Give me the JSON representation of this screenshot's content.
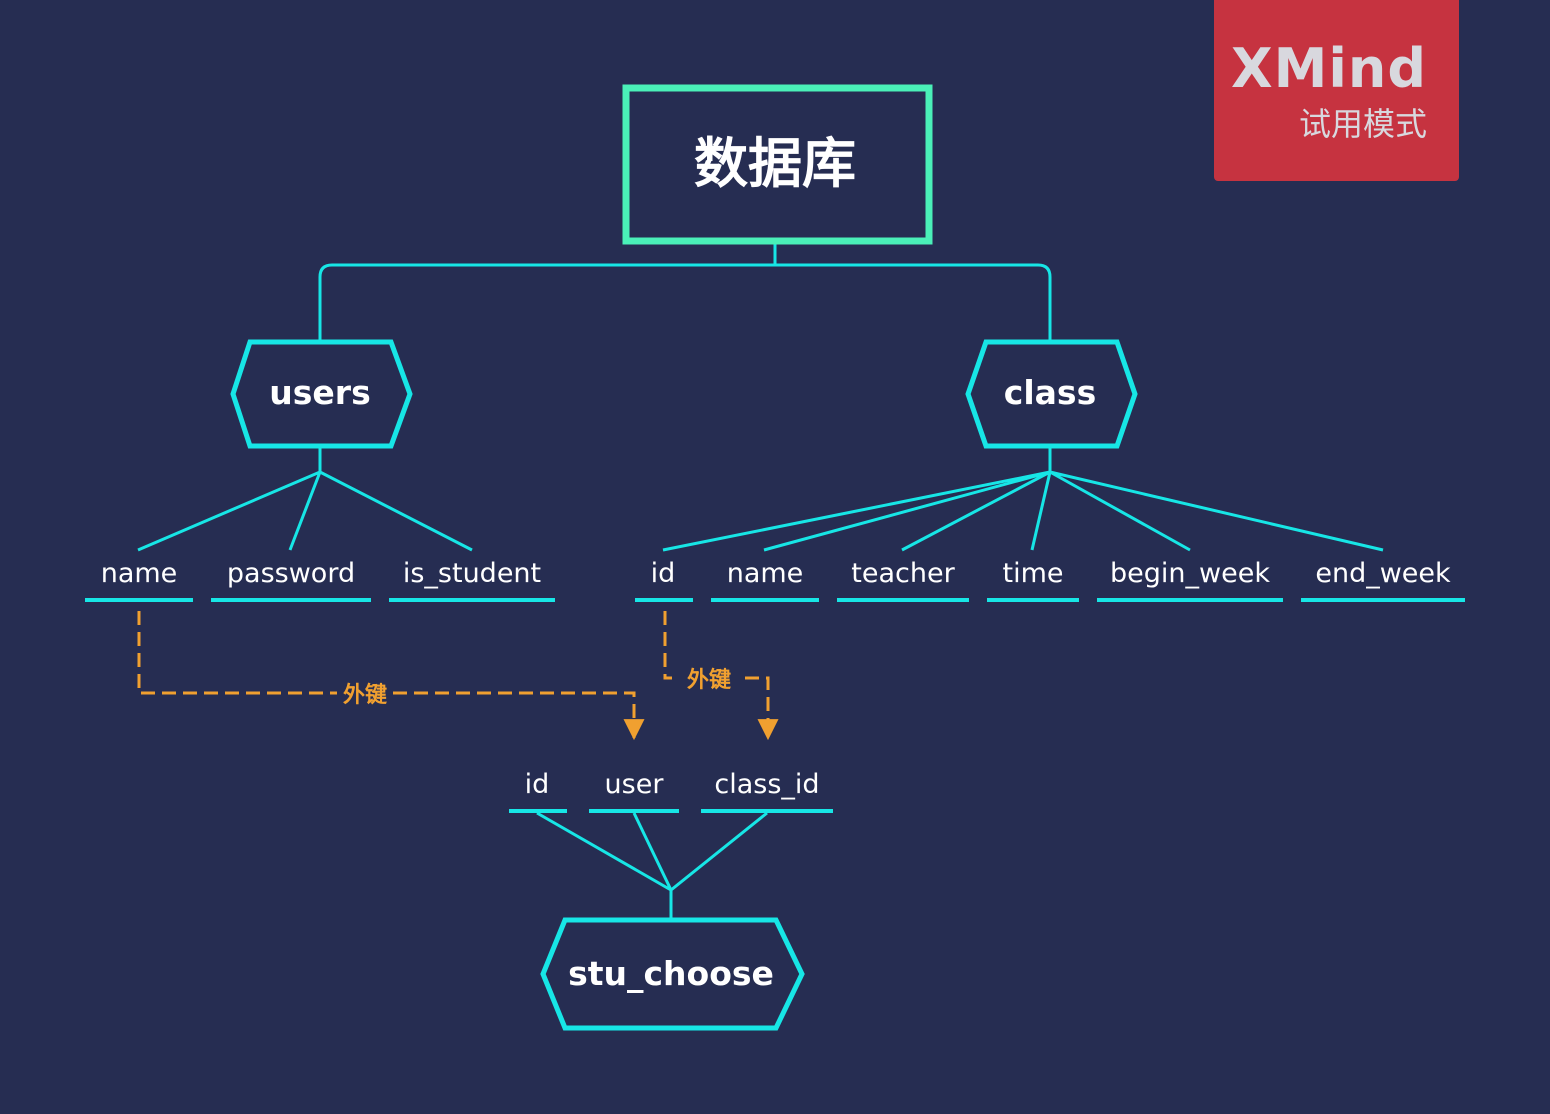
{
  "watermark": {
    "brand": "XMind",
    "mode": "试用模式"
  },
  "colors": {
    "background": "#262d52",
    "root_border": "#4af0b8",
    "branch_line": "#17e6e6",
    "foreign_key": "#f0a030",
    "text": "#ffffff"
  },
  "root": {
    "label": "数据库"
  },
  "tables": [
    {
      "id": "users",
      "label": "users",
      "fields": [
        "name",
        "password",
        "is_student"
      ]
    },
    {
      "id": "class",
      "label": "class",
      "fields": [
        "id",
        "name",
        "teacher",
        "time",
        "begin_week",
        "end_week"
      ]
    },
    {
      "id": "stu_choose",
      "label": "stu_choose",
      "fields": [
        "id",
        "user",
        "class_id"
      ]
    }
  ],
  "relations": [
    {
      "label": "外键",
      "from": "users.name",
      "to": "stu_choose.user"
    },
    {
      "label": "外键",
      "from": "class.id",
      "to": "stu_choose.class_id"
    }
  ]
}
